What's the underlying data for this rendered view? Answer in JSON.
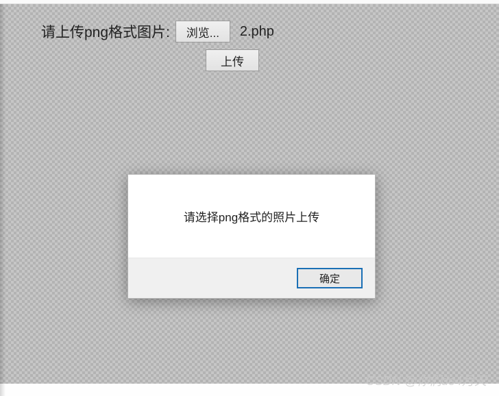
{
  "upload": {
    "prompt": "请上传png格式图片:",
    "browse_label": "浏览...",
    "filename": "2.php",
    "submit_label": "上传"
  },
  "dialog": {
    "message": "请选择png格式的照片上传",
    "ok_label": "确定"
  },
  "watermark": "CSDN @你们de4月天"
}
